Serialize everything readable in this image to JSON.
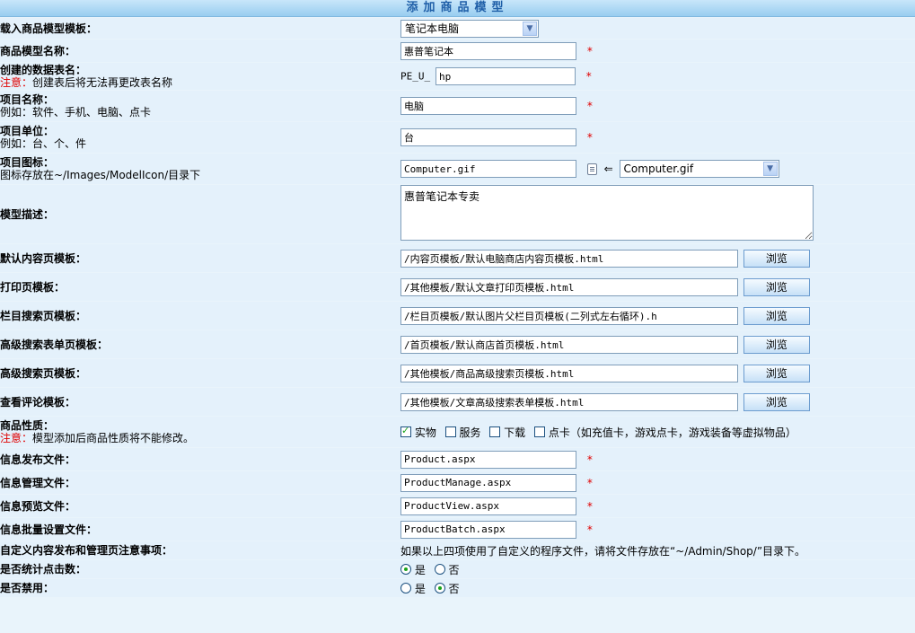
{
  "page_title": "添加商品模型",
  "rows": {
    "template_load": {
      "label": "载入商品模型模板：",
      "selected": "笔记本电脑"
    },
    "model_name": {
      "label": "商品模型名称：",
      "value": "惠普笔记本",
      "required": "*"
    },
    "table_name": {
      "label": "创建的数据表名：",
      "warn": "注意：",
      "hint": "创建表后将无法再更改表名称",
      "prefix": "PE_U_",
      "value": "hp",
      "required": "*"
    },
    "item_name": {
      "label": "项目名称：",
      "hint": "例如：软件、手机、电脑、点卡",
      "value": "电脑",
      "required": "*"
    },
    "item_unit": {
      "label": "项目单位：",
      "hint": "例如：台、个、件",
      "value": "台",
      "required": "*"
    },
    "item_icon": {
      "label": "项目图标：",
      "hint": "图标存放在~/Images/ModelIcon/目录下",
      "value": "Computer.gif",
      "arrow": "⇐",
      "selected": "Computer.gif"
    },
    "description": {
      "label": "模型描述：",
      "value": "惠普笔记本专卖"
    },
    "content_tpl": {
      "label": "默认内容页模板：",
      "value": "/内容页模板/默认电脑商店内容页模板.html",
      "button": "浏览"
    },
    "print_tpl": {
      "label": "打印页模板：",
      "value": "/其他模板/默认文章打印页模板.html",
      "button": "浏览"
    },
    "search_tpl": {
      "label": "栏目搜索页模板：",
      "value": "/栏目页模板/默认图片父栏目页模板(二列式左右循环).h",
      "button": "浏览"
    },
    "adv_form_tpl": {
      "label": "高级搜索表单页模板：",
      "value": "/首页模板/默认商店首页模板.html",
      "button": "浏览"
    },
    "adv_search_tpl": {
      "label": "高级搜索页模板：",
      "value": "/其他模板/商品高级搜索页模板.html",
      "button": "浏览"
    },
    "comment_tpl": {
      "label": "查看评论模板：",
      "value": "/其他模板/文章高级搜索表单模板.html",
      "button": "浏览"
    },
    "nature": {
      "label": "商品性质：",
      "warn": "注意：",
      "hint": "模型添加后商品性质将不能修改。",
      "options": [
        "实物",
        "服务",
        "下载",
        "点卡（如充值卡，游戏点卡，游戏装备等虚拟物品）"
      ]
    },
    "publish_file": {
      "label": "信息发布文件：",
      "value": "Product.aspx",
      "required": "*"
    },
    "manage_file": {
      "label": "信息管理文件：",
      "value": "ProductManage.aspx",
      "required": "*"
    },
    "preview_file": {
      "label": "信息预览文件：",
      "value": "ProductView.aspx",
      "required": "*"
    },
    "batch_file": {
      "label": "信息批量设置文件：",
      "value": "ProductBatch.aspx",
      "required": "*"
    },
    "custom_notes": {
      "label": "自定义内容发布和管理页注意事项：",
      "text": "如果以上四项使用了自定义的程序文件，请将文件存放在“~/Admin/Shop/”目录下。"
    },
    "count_clicks": {
      "label": "是否统计点击数：",
      "yes": "是",
      "no": "否"
    },
    "disabled": {
      "label": "是否禁用：",
      "yes": "是",
      "no": "否"
    }
  }
}
